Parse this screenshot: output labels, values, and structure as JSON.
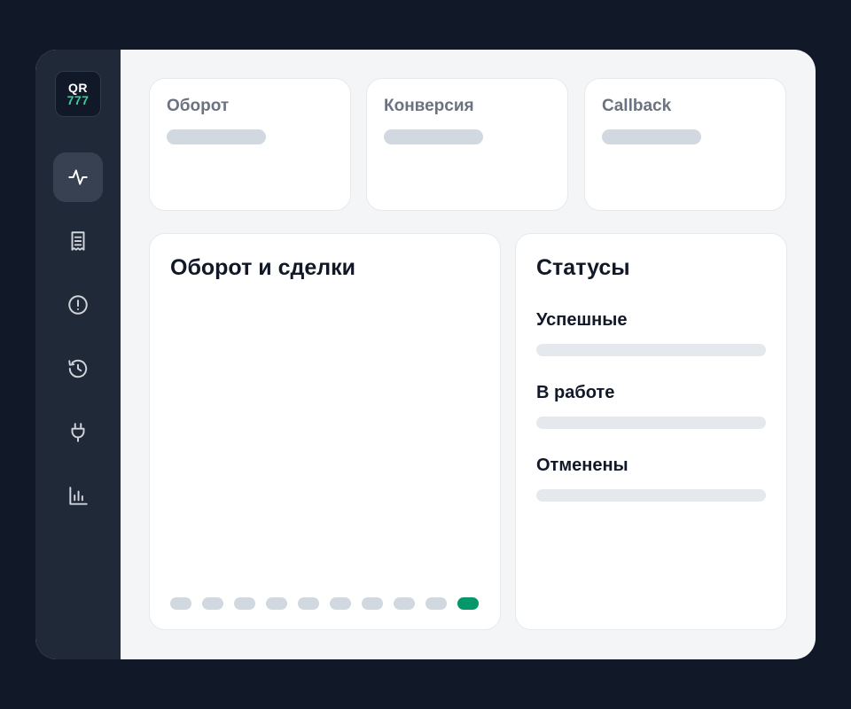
{
  "logo": {
    "line1": "QR",
    "line2": "777"
  },
  "nav": {
    "items": [
      {
        "icon": "activity-icon",
        "active": true
      },
      {
        "icon": "receipt-icon",
        "active": false
      },
      {
        "icon": "alert-circle-icon",
        "active": false
      },
      {
        "icon": "history-icon",
        "active": false
      },
      {
        "icon": "plug-icon",
        "active": false
      },
      {
        "icon": "bar-chart-icon",
        "active": false
      }
    ]
  },
  "stats": {
    "turnover": {
      "label": "Оборот"
    },
    "conversion": {
      "label": "Конверсия"
    },
    "callback": {
      "label": "Callback"
    }
  },
  "chart_panel": {
    "title": "Оборот и сделки",
    "pager": {
      "count": 10,
      "active_index": 9
    }
  },
  "status_panel": {
    "title": "Статусы",
    "items": [
      {
        "label": "Успешные"
      },
      {
        "label": "В работе"
      },
      {
        "label": "Отменены"
      }
    ]
  },
  "colors": {
    "page_bg": "#111827",
    "sidebar_bg": "#1f2937",
    "accent": "#059669",
    "logo_accent": "#34d399"
  }
}
